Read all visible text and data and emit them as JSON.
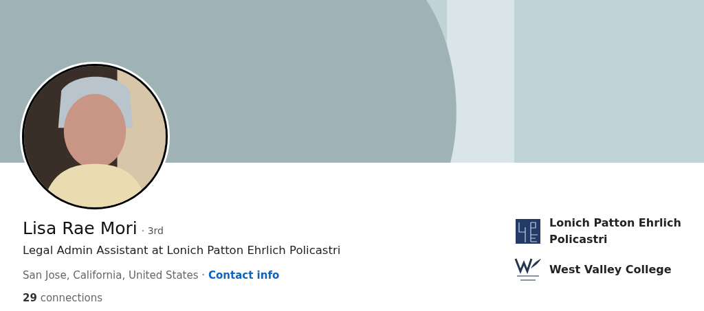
{
  "name": "Lisa Rae Mori",
  "degree": "· 3rd",
  "headline": "Legal Admin Assistant at Lonich Patton Ehrlich Policastri",
  "location": "San Jose, California, United States ·",
  "contact_link": "Contact info",
  "connections": "**29** connections",
  "experience": [
    {
      "kind": "firm",
      "name": "Lonich Patton Ehrlich Policastri"
    },
    {
      "kind": "college",
      "name": "West Valley College"
    }
  ]
}
